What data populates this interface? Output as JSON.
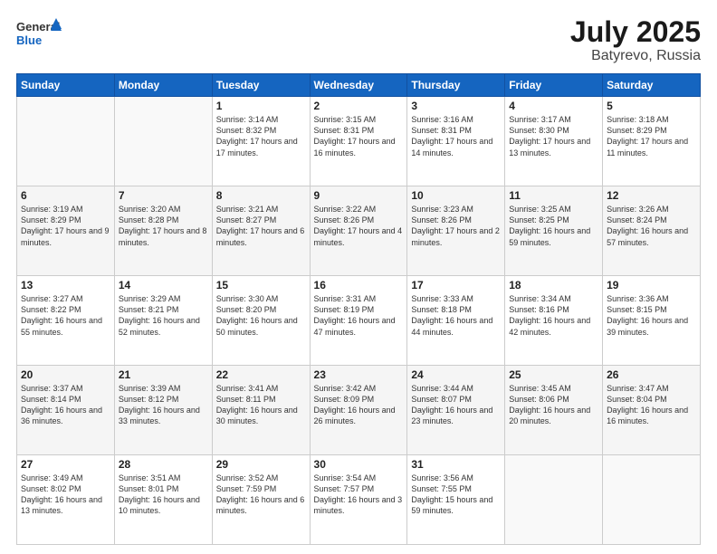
{
  "header": {
    "title": "July 2025",
    "subtitle": "Batyrevo, Russia"
  },
  "columns": [
    "Sunday",
    "Monday",
    "Tuesday",
    "Wednesday",
    "Thursday",
    "Friday",
    "Saturday"
  ],
  "weeks": [
    [
      {
        "day": "",
        "info": ""
      },
      {
        "day": "",
        "info": ""
      },
      {
        "day": "1",
        "info": "Sunrise: 3:14 AM\nSunset: 8:32 PM\nDaylight: 17 hours\nand 17 minutes."
      },
      {
        "day": "2",
        "info": "Sunrise: 3:15 AM\nSunset: 8:31 PM\nDaylight: 17 hours\nand 16 minutes."
      },
      {
        "day": "3",
        "info": "Sunrise: 3:16 AM\nSunset: 8:31 PM\nDaylight: 17 hours\nand 14 minutes."
      },
      {
        "day": "4",
        "info": "Sunrise: 3:17 AM\nSunset: 8:30 PM\nDaylight: 17 hours\nand 13 minutes."
      },
      {
        "day": "5",
        "info": "Sunrise: 3:18 AM\nSunset: 8:29 PM\nDaylight: 17 hours\nand 11 minutes."
      }
    ],
    [
      {
        "day": "6",
        "info": "Sunrise: 3:19 AM\nSunset: 8:29 PM\nDaylight: 17 hours\nand 9 minutes."
      },
      {
        "day": "7",
        "info": "Sunrise: 3:20 AM\nSunset: 8:28 PM\nDaylight: 17 hours\nand 8 minutes."
      },
      {
        "day": "8",
        "info": "Sunrise: 3:21 AM\nSunset: 8:27 PM\nDaylight: 17 hours\nand 6 minutes."
      },
      {
        "day": "9",
        "info": "Sunrise: 3:22 AM\nSunset: 8:26 PM\nDaylight: 17 hours\nand 4 minutes."
      },
      {
        "day": "10",
        "info": "Sunrise: 3:23 AM\nSunset: 8:26 PM\nDaylight: 17 hours\nand 2 minutes."
      },
      {
        "day": "11",
        "info": "Sunrise: 3:25 AM\nSunset: 8:25 PM\nDaylight: 16 hours\nand 59 minutes."
      },
      {
        "day": "12",
        "info": "Sunrise: 3:26 AM\nSunset: 8:24 PM\nDaylight: 16 hours\nand 57 minutes."
      }
    ],
    [
      {
        "day": "13",
        "info": "Sunrise: 3:27 AM\nSunset: 8:22 PM\nDaylight: 16 hours\nand 55 minutes."
      },
      {
        "day": "14",
        "info": "Sunrise: 3:29 AM\nSunset: 8:21 PM\nDaylight: 16 hours\nand 52 minutes."
      },
      {
        "day": "15",
        "info": "Sunrise: 3:30 AM\nSunset: 8:20 PM\nDaylight: 16 hours\nand 50 minutes."
      },
      {
        "day": "16",
        "info": "Sunrise: 3:31 AM\nSunset: 8:19 PM\nDaylight: 16 hours\nand 47 minutes."
      },
      {
        "day": "17",
        "info": "Sunrise: 3:33 AM\nSunset: 8:18 PM\nDaylight: 16 hours\nand 44 minutes."
      },
      {
        "day": "18",
        "info": "Sunrise: 3:34 AM\nSunset: 8:16 PM\nDaylight: 16 hours\nand 42 minutes."
      },
      {
        "day": "19",
        "info": "Sunrise: 3:36 AM\nSunset: 8:15 PM\nDaylight: 16 hours\nand 39 minutes."
      }
    ],
    [
      {
        "day": "20",
        "info": "Sunrise: 3:37 AM\nSunset: 8:14 PM\nDaylight: 16 hours\nand 36 minutes."
      },
      {
        "day": "21",
        "info": "Sunrise: 3:39 AM\nSunset: 8:12 PM\nDaylight: 16 hours\nand 33 minutes."
      },
      {
        "day": "22",
        "info": "Sunrise: 3:41 AM\nSunset: 8:11 PM\nDaylight: 16 hours\nand 30 minutes."
      },
      {
        "day": "23",
        "info": "Sunrise: 3:42 AM\nSunset: 8:09 PM\nDaylight: 16 hours\nand 26 minutes."
      },
      {
        "day": "24",
        "info": "Sunrise: 3:44 AM\nSunset: 8:07 PM\nDaylight: 16 hours\nand 23 minutes."
      },
      {
        "day": "25",
        "info": "Sunrise: 3:45 AM\nSunset: 8:06 PM\nDaylight: 16 hours\nand 20 minutes."
      },
      {
        "day": "26",
        "info": "Sunrise: 3:47 AM\nSunset: 8:04 PM\nDaylight: 16 hours\nand 16 minutes."
      }
    ],
    [
      {
        "day": "27",
        "info": "Sunrise: 3:49 AM\nSunset: 8:02 PM\nDaylight: 16 hours\nand 13 minutes."
      },
      {
        "day": "28",
        "info": "Sunrise: 3:51 AM\nSunset: 8:01 PM\nDaylight: 16 hours\nand 10 minutes."
      },
      {
        "day": "29",
        "info": "Sunrise: 3:52 AM\nSunset: 7:59 PM\nDaylight: 16 hours\nand 6 minutes."
      },
      {
        "day": "30",
        "info": "Sunrise: 3:54 AM\nSunset: 7:57 PM\nDaylight: 16 hours\nand 3 minutes."
      },
      {
        "day": "31",
        "info": "Sunrise: 3:56 AM\nSunset: 7:55 PM\nDaylight: 15 hours\nand 59 minutes."
      },
      {
        "day": "",
        "info": ""
      },
      {
        "day": "",
        "info": ""
      }
    ]
  ]
}
